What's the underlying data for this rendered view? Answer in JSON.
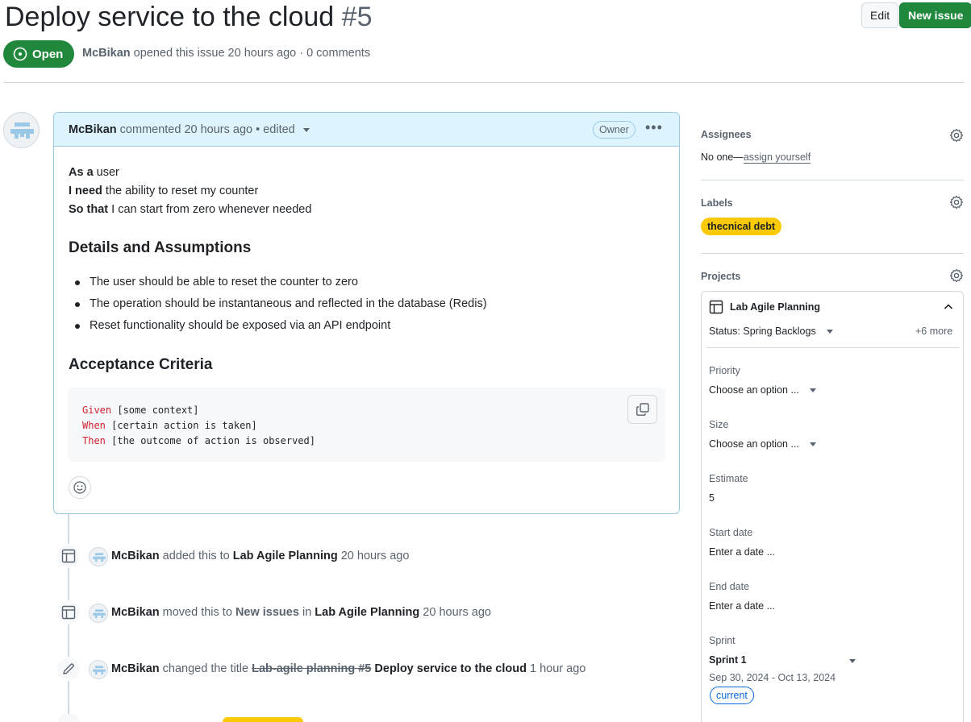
{
  "issue": {
    "title": "Deploy service to the cloud",
    "number": "#5",
    "state": "Open",
    "author": "McBikan",
    "meta_rest": "opened this issue 20 hours ago · 0 comments"
  },
  "header_buttons": {
    "edit": "Edit",
    "new_issue": "New issue"
  },
  "comment": {
    "author": "McBikan",
    "meta": "commented 20 hours ago • edited",
    "role_badge": "Owner",
    "menu_glyph": "•••",
    "story": [
      {
        "strong": "As a",
        "rest": " user"
      },
      {
        "strong": "I need",
        "rest": " the ability to reset my counter"
      },
      {
        "strong": "So that",
        "rest": " I can start from zero whenever needed"
      }
    ],
    "details_heading": "Details and Assumptions",
    "details": [
      "The user should be able to reset the counter to zero",
      "The operation should be instantaneous and reflected in the database (Redis)",
      "Reset functionality should be exposed via an API endpoint"
    ],
    "acceptance_heading": "Acceptance Criteria",
    "code": [
      {
        "kw": "Given",
        "rest": " [some context]"
      },
      {
        "kw": "When",
        "rest": " [certain action is taken]"
      },
      {
        "kw": "Then",
        "rest": " [the outcome of action is observed]"
      }
    ]
  },
  "timeline": {
    "added": {
      "actor": "McBikan",
      "action": " added this to ",
      "project": "Lab Agile Planning",
      "time": " 20 hours ago"
    },
    "moved": {
      "actor": "McBikan",
      "action": " moved this to ",
      "column": "New issues",
      "in": " in ",
      "project": "Lab Agile Planning",
      "time": " 20 hours ago"
    },
    "renamed": {
      "actor": "McBikan",
      "action": " changed the title ",
      "old_title": "Lab-agile planning #5",
      "new_title": "Deploy service to the cloud",
      "time": " 1 hour ago"
    }
  },
  "sidebar": {
    "assignees_label": "Assignees",
    "assignees_value": "No one—",
    "assign_yourself": "assign yourself",
    "labels_label": "Labels",
    "label_pill": "thecnical debt",
    "label_color": "#fbca04",
    "projects_label": "Projects",
    "project": {
      "name": "Lab Agile Planning",
      "status": "Status: Spring Backlogs",
      "more": "+6 more",
      "priority_label": "Priority",
      "priority_value": "Choose an option ...",
      "size_label": "Size",
      "size_value": "Choose an option ...",
      "estimate_label": "Estimate",
      "estimate_value": "5",
      "start_label": "Start date",
      "start_value": "Enter a date ...",
      "end_label": "End date",
      "end_value": "Enter a date ...",
      "sprint_label": "Sprint",
      "sprint_value": "Sprint 1",
      "sprint_range": "Sep 30, 2024 - Oct 13, 2024",
      "sprint_badge": "current"
    }
  },
  "colors": {
    "open_green": "#1f883d",
    "comment_header": "#ddf4ff",
    "code_keyword": "#cf222e",
    "link_blue": "#0969da"
  },
  "icons": [
    "issue-open-icon",
    "kebab-icon",
    "copy-icon",
    "smiley-icon",
    "table-icon",
    "pencil-icon",
    "gear-icon",
    "chevron-up-icon",
    "caret-down-icon"
  ]
}
